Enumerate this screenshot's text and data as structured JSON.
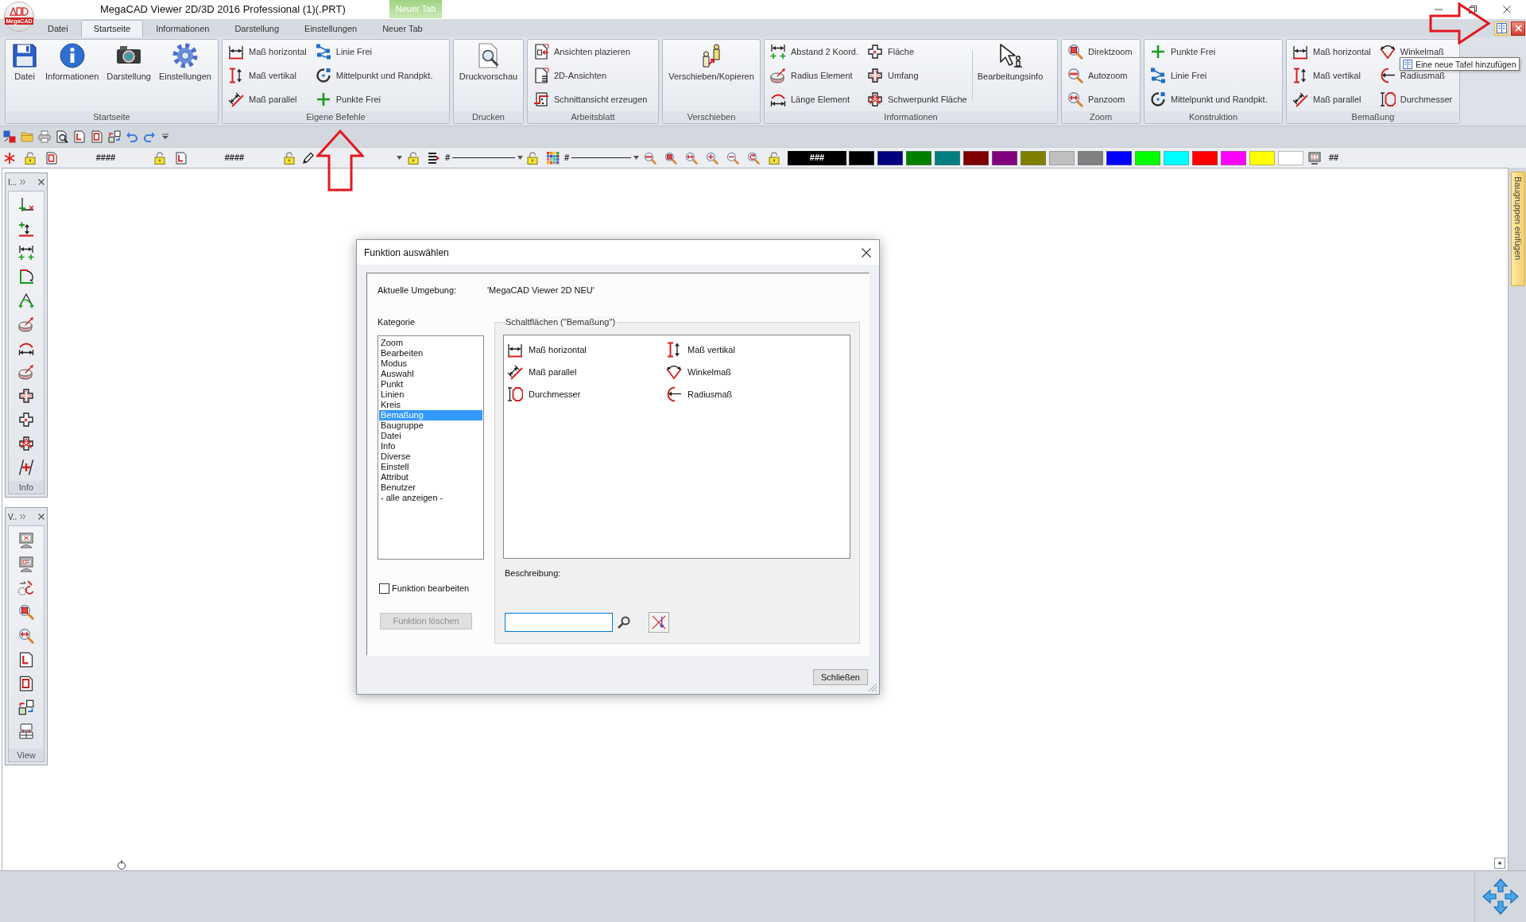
{
  "window": {
    "title": "MegaCAD Viewer 2D/3D 2016 Professional (1)(.PRT)",
    "logo_text": "MegaCAD",
    "contextual_tab_header": "Neuer Tab"
  },
  "ribbon": {
    "tabs": [
      {
        "label": "Datei",
        "selected": false
      },
      {
        "label": "Startseite",
        "selected": true
      },
      {
        "label": "Informationen",
        "selected": false
      },
      {
        "label": "Darstellung",
        "selected": false
      },
      {
        "label": "Einstellungen",
        "selected": false
      },
      {
        "label": "Neuer Tab",
        "selected": false
      }
    ],
    "groups": [
      {
        "title": "Startseite",
        "items": [
          {
            "label": "Datei",
            "kind": "large"
          },
          {
            "label": "Informationen",
            "kind": "large"
          },
          {
            "label": "Darstellung",
            "kind": "large"
          },
          {
            "label": "Einstellungen",
            "kind": "large"
          }
        ]
      },
      {
        "title": "Eigene Befehle",
        "items": [
          {
            "label": "Maß horizontal",
            "kind": "small"
          },
          {
            "label": "Maß vertikal",
            "kind": "small"
          },
          {
            "label": "Maß parallel",
            "kind": "small"
          },
          {
            "label": "Linie Frei",
            "kind": "small"
          },
          {
            "label": "Mittelpunkt und Randpkt.",
            "kind": "small"
          },
          {
            "label": "Punkte Frei",
            "kind": "small"
          }
        ]
      },
      {
        "title": "Drucken",
        "items": [
          {
            "label": "Druckvorschau",
            "kind": "large"
          }
        ]
      },
      {
        "title": "Arbeitsblatt",
        "items": [
          {
            "label": "Ansichten plazieren",
            "kind": "small"
          },
          {
            "label": "2D-Ansichten",
            "kind": "small"
          },
          {
            "label": "Schnittansicht erzeugen",
            "kind": "small"
          }
        ]
      },
      {
        "title": "Verschieben",
        "items": [
          {
            "label": "Verschieben/Kopieren",
            "kind": "large"
          }
        ]
      },
      {
        "title": "Informationen",
        "items": [
          {
            "label": "Abstand 2 Koord.",
            "kind": "small"
          },
          {
            "label": "Radius Element",
            "kind": "small"
          },
          {
            "label": "Länge Element",
            "kind": "small"
          },
          {
            "label": "Fläche",
            "kind": "small"
          },
          {
            "label": "Umfang",
            "kind": "small"
          },
          {
            "label": "Schwerpunkt Fläche",
            "kind": "small"
          },
          {
            "label": "Bearbeitungsinfo",
            "kind": "large"
          }
        ]
      },
      {
        "title": "Zoom",
        "items": [
          {
            "label": "Direktzoom",
            "kind": "small"
          },
          {
            "label": "Autozoom",
            "kind": "small"
          },
          {
            "label": "Panzoom",
            "kind": "small"
          }
        ]
      },
      {
        "title": "Konstruktion",
        "items": [
          {
            "label": "Punkte Frei",
            "kind": "small"
          },
          {
            "label": "Linie Frei",
            "kind": "small"
          },
          {
            "label": "Mittelpunkt und Randpkt.",
            "kind": "small"
          }
        ]
      },
      {
        "title": "Bemaßung",
        "items": [
          {
            "label": "Maß horizontal",
            "kind": "small"
          },
          {
            "label": "Maß vertikal",
            "kind": "small"
          },
          {
            "label": "Maß parallel",
            "kind": "small"
          },
          {
            "label": "Winkelmaß",
            "kind": "small"
          },
          {
            "label": "Radiusmaß",
            "kind": "small"
          },
          {
            "label": "Durchmesser",
            "kind": "small"
          }
        ]
      }
    ],
    "tooltip": "Eine neue Tafel hinzufügen"
  },
  "format_toolbar": {
    "text_fields": [
      "####",
      "####"
    ],
    "line_dropdowns": [
      "#",
      "#"
    ],
    "current_color": {
      "label": "###",
      "color": "#000000"
    },
    "palette": [
      {
        "color": "#000000"
      },
      {
        "color": "#000080"
      },
      {
        "color": "#008000"
      },
      {
        "color": "#008080"
      },
      {
        "color": "#800000"
      },
      {
        "color": "#800080"
      },
      {
        "color": "#808000"
      },
      {
        "color": "#c0c0c0"
      },
      {
        "color": "#808080"
      },
      {
        "color": "#0000ff"
      },
      {
        "color": "#00ff00"
      },
      {
        "color": "#00ffff"
      },
      {
        "color": "#ff0000"
      },
      {
        "color": "#ff00ff"
      },
      {
        "color": "#ffff00"
      },
      {
        "color": "#ffffff"
      }
    ],
    "trailing_label": "##"
  },
  "docked_toolbars": [
    {
      "title": "I...",
      "footer": "Info"
    },
    {
      "title": "V..",
      "footer": "View"
    }
  ],
  "side_tabs": [
    {
      "label": "Baugruppen einfügen"
    }
  ],
  "dialog": {
    "title": "Funktion auswählen",
    "environment_label": "Aktuelle Umgebung:",
    "environment_value": "'MegaCAD Viewer 2D NEU'",
    "category_label": "Kategorie",
    "categories": [
      {
        "label": "Zoom",
        "selected": false
      },
      {
        "label": "Bearbeiten",
        "selected": false
      },
      {
        "label": "Modus",
        "selected": false
      },
      {
        "label": "Auswahl",
        "selected": false
      },
      {
        "label": "Punkt",
        "selected": false
      },
      {
        "label": "Linien",
        "selected": false
      },
      {
        "label": "Kreis",
        "selected": false
      },
      {
        "label": "Bemaßung",
        "selected": true
      },
      {
        "label": "Baugruppe",
        "selected": false
      },
      {
        "label": "Datei",
        "selected": false
      },
      {
        "label": "Info",
        "selected": false
      },
      {
        "label": "Diverse",
        "selected": false
      },
      {
        "label": "Einstell",
        "selected": false
      },
      {
        "label": "Attribut",
        "selected": false
      },
      {
        "label": "Benutzer",
        "selected": false
      },
      {
        "label": "- alle anzeigen -",
        "selected": false
      }
    ],
    "function_group_title": "Schaltflächen (\"Bemaßung\")",
    "functions": [
      {
        "label": "Maß horizontal",
        "selected": false
      },
      {
        "label": "Maß vertikal",
        "selected": false
      },
      {
        "label": "Maß parallel",
        "selected": false
      },
      {
        "label": "Winkelmaß",
        "selected": false
      },
      {
        "label": "Durchmesser",
        "selected": false
      },
      {
        "label": "Radiusmaß",
        "selected": false
      }
    ],
    "description_label": "Beschreibung:",
    "edit_checkbox": {
      "label": "Funktion bearbeiten",
      "checked": false
    },
    "delete_button": {
      "label": "Funktion löschen",
      "disabled": true
    },
    "close_button": {
      "label": "Schließen"
    }
  }
}
